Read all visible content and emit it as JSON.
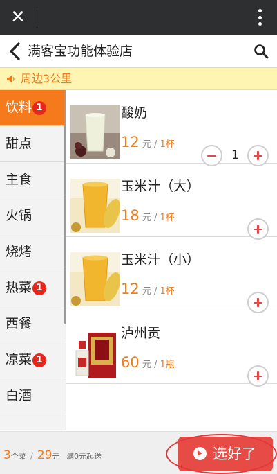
{
  "topbar": {
    "close_icon": "close-icon",
    "more_icon": "more-vertical-icon"
  },
  "header": {
    "title": "满客宝功能体验店",
    "back_icon": "chevron-left-icon",
    "search_icon": "search-icon"
  },
  "notice": {
    "icon": "speaker-icon",
    "text": "周边3公里"
  },
  "categories": [
    {
      "label": "饮料",
      "badge": "1",
      "active": true
    },
    {
      "label": "甜点",
      "badge": ""
    },
    {
      "label": "主食",
      "badge": ""
    },
    {
      "label": "火锅",
      "badge": ""
    },
    {
      "label": "烧烤",
      "badge": ""
    },
    {
      "label": "热菜",
      "badge": "1"
    },
    {
      "label": "西餐",
      "badge": ""
    },
    {
      "label": "凉菜",
      "badge": "1"
    },
    {
      "label": "白酒",
      "badge": ""
    }
  ],
  "products": [
    {
      "name": "酸奶",
      "price": "12",
      "unit": " 元 / ",
      "per": "1杯",
      "quantity": "1",
      "image": "yogurt-image"
    },
    {
      "name": "玉米汁（大）",
      "price": "18",
      "unit": " 元 / ",
      "per": "1杯",
      "quantity": "",
      "image": "corn-juice-image"
    },
    {
      "name": "玉米汁（小）",
      "price": "12",
      "unit": " 元 / ",
      "per": "1杯",
      "quantity": "",
      "image": "corn-juice-image"
    },
    {
      "name": "泸州贡",
      "price": "60",
      "unit": " 元 / ",
      "per": "1瓶",
      "quantity": "",
      "image": "liquor-bottle-image"
    }
  ],
  "footer": {
    "count": "3",
    "count_unit": "个菜",
    "total": "29",
    "total_unit": "元",
    "minimum": "满0元起送",
    "confirm_label": "选好了",
    "confirm_icon": "arrow-right-circle-icon"
  },
  "colors": {
    "accent": "#f57a1b",
    "price": "#f07c1a",
    "button": "#e64b45",
    "badge": "#e8261c",
    "topbar": "#2e2f31"
  }
}
